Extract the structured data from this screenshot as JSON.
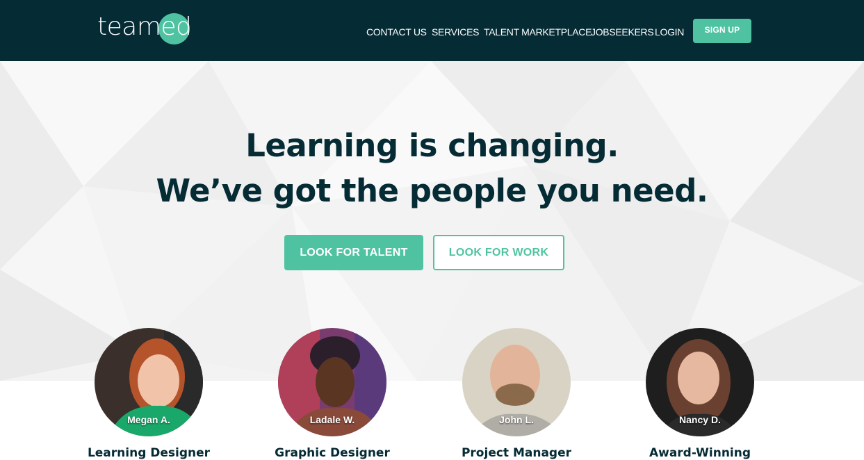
{
  "nav": {
    "logo_text": "teamed",
    "links": [
      "CONTACT US",
      "SERVICES",
      "TALENT MARKETPLACE",
      "JOBSEEKERS",
      "LOGIN"
    ],
    "signup_label": "SIGN UP"
  },
  "hero": {
    "headline_line1": "Learning is changing.",
    "headline_line2": "We’ve got the people you need.",
    "look_for_talent_label": "LOOK FOR TALENT",
    "look_for_work_label": "LOOK FOR WORK"
  },
  "people": [
    {
      "name": "Megan A.",
      "role": "Learning Designer"
    },
    {
      "name": "Ladale W.",
      "role": "Graphic Designer"
    },
    {
      "name": "John L.",
      "role": "Project Manager"
    },
    {
      "name": "Nancy D.",
      "role": "Award-Winning"
    }
  ],
  "colors": {
    "navy": "#052b35",
    "accent": "#4fc3a1"
  }
}
